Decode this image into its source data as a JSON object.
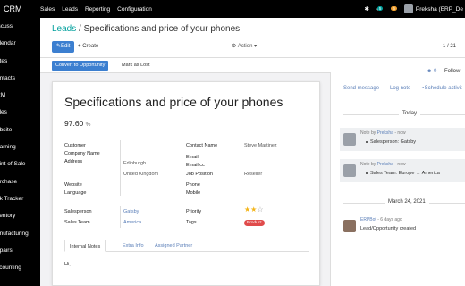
{
  "topbar": {
    "app_title": "CRM",
    "menu": [
      "Sales",
      "Leads",
      "Reporting",
      "Configuration"
    ],
    "messages_count": "5",
    "activities_count": "6",
    "user_name": "Preksha (ERP_De"
  },
  "sidebar": {
    "items": [
      "iscuss",
      "alendar",
      "otes",
      "ontacts",
      "RM",
      "ales",
      "ebsite",
      "earning",
      "oint of Sale",
      "urchase",
      "nk Tracker",
      "ventory",
      "anufacturing",
      "epairs",
      "ccounting"
    ]
  },
  "control": {
    "breadcrumb_parent": "Leads",
    "breadcrumb_separator": "/",
    "breadcrumb_current": "Specifications and price of your phones",
    "edit_label": "Edit",
    "create_label": "Create",
    "action_label": "Action",
    "pager": "1 / 21"
  },
  "statusbar": {
    "convert_label": "Convert to Opportunity",
    "lost_label": "Mark as Lost"
  },
  "form": {
    "title": "Specifications and price of your phones",
    "probability": "97.60",
    "probability_unit": "%",
    "labels": {
      "customer": "Customer",
      "company_name": "Company Name",
      "address": "Address",
      "website": "Website",
      "language": "Language",
      "contact_name": "Contact Name",
      "email": "Email",
      "email_cc": "Email cc",
      "job_position": "Job Position",
      "phone": "Phone",
      "mobile": "Mobile",
      "salesperson": "Salesperson",
      "sales_team": "Sales Team",
      "priority": "Priority",
      "tags": "Tags"
    },
    "values": {
      "contact_name": "Steve Martinez",
      "address_city": "Edinburgh",
      "address_country": "United Kingdom",
      "job_position": "Reseller",
      "salesperson": "Gatsby",
      "sales_team": "America",
      "priority_stars": 2,
      "priority_max": 3,
      "tag": "Product"
    },
    "tabs": [
      "Internal Notes",
      "Extra Info",
      "Assigned Partner"
    ],
    "note_text": "Hi,"
  },
  "chatter": {
    "follower_count": "0",
    "follow_label": "Follow",
    "send_message": "Send message",
    "log_note": "Log note",
    "schedule_activity": "Schedule activit",
    "divider_today": "Today",
    "divider_date": "March 24, 2021",
    "messages": [
      {
        "prefix": "Note by",
        "author": "Preksha",
        "time": "- now",
        "body": "Salesperson: Gatsby"
      },
      {
        "prefix": "Note by",
        "author": "Preksha",
        "time": "- now",
        "body": "Sales Team: Europe → America"
      },
      {
        "prefix": "",
        "author": "ERPBot",
        "time": "- 6 days ago",
        "body": "Lead/Opportunity created"
      }
    ]
  },
  "colors": {
    "accent": "#00a09d",
    "primary_button": "#3c7fd0",
    "link": "#5b7fb8",
    "tag_red": "#e04b4b",
    "star": "#f3b51b"
  }
}
